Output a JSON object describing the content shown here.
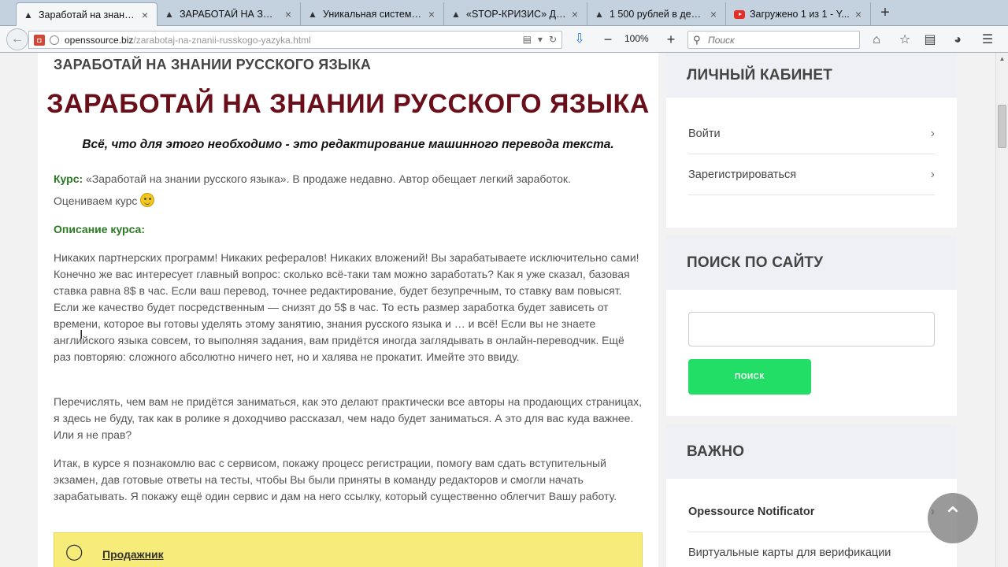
{
  "browser": {
    "tabs": [
      {
        "label": "Заработай на знани...",
        "active": true,
        "icon": "page-icon"
      },
      {
        "label": "ЗАРАБОТАЙ НА ЗНАНИ...",
        "active": false,
        "icon": "page-icon"
      },
      {
        "label": "Уникальная система...",
        "active": false,
        "icon": "page-icon"
      },
      {
        "label": "«STOP-КРИЗИС» До...",
        "active": false,
        "icon": "page-icon"
      },
      {
        "label": "1 500 рублей в день ...",
        "active": false,
        "icon": "page-icon"
      },
      {
        "label": "Загружено 1 из 1 - Y...",
        "active": false,
        "icon": "youtube-icon"
      }
    ],
    "new_tab": "+",
    "url_domain": "openssource.biz",
    "url_path": "/zarabotaj-na-znanii-russkogo-yazyka.html",
    "zoom_minus": "−",
    "zoom_level": "100%",
    "zoom_plus": "+",
    "search_placeholder": "Поиск",
    "accent": "#2a7fd4"
  },
  "article": {
    "breadcrumb_title": "ЗАРАБОТАЙ НА ЗНАНИИ РУССКОГО ЯЗЫКА",
    "title": "ЗАРАБОТАЙ НА ЗНАНИИ РУССКОГО ЯЗЫКА",
    "subtitle": "Всё, что для этого необходимо - это редактирование машинного перевода текста.",
    "course_label": "Курс:",
    "course_text_1": " «Заработай на знании русского языка». В продаже недавно. Автор обещает легкий заработок.",
    "course_text_2": "Оцениваем курс",
    "description_label": "Описание курса:",
    "paragraph_1": "Никаких партнерских программ! Никаких рефералов! Никаких вложений! Вы зарабатываете исключительно сами!  Конечно же вас интересует главный вопрос: сколько всё-таки там можно заработать? Как я уже сказал, базовая ставка равна 8$ в час. Если ваш перевод, точнее редактирование, будет безупречным, то ставку вам повысят. Если же качество будет посредственным — снизят до 5$ в час. То есть размер заработка будет зависеть от времени, которое вы готовы уделять этому занятию, знания русского языка и … и всё! Если вы не знаете английского языка совсем, то выполняя задания, вам придётся иногда заглядывать в онлайн-переводчик. Ещё раз повторяю: сложного абсолютно ничего нет, но и халява не прокатит. Имейте это ввиду.",
    "paragraph_2": "Перечислять, чем вам не придётся заниматься, как это делают практически все авторы на продающих страницах, я здесь не буду, так как в ролике я доходчиво рассказал, чем надо будет заниматься. А это для вас куда важнее. Или я не прав?",
    "paragraph_3": "Итак, в курсе я познакомлю вас с сервисом, покажу процесс регистрации, помогу вам сдать вступительный экзамен, дав готовые ответы на тесты, чтобы Вы были приняты в команду редакторов и смогли начать зарабатывать. Я покажу ещё один сервис и дам на него ссылку, который существенно облегчит Вашу работу.",
    "tip_link": "Продажник",
    "title_color": "#6a0f1a",
    "label_color": "#2a7a22"
  },
  "sidebar": {
    "account": {
      "heading": "ЛИЧНЫЙ КАБИНЕТ",
      "items": [
        {
          "label": "Войти"
        },
        {
          "label": "Зарегистрироваться"
        }
      ]
    },
    "search": {
      "heading": "ПОИСК ПО САЙТУ",
      "value": "",
      "button": "ПОИСК",
      "button_color": "#22dd66"
    },
    "important": {
      "heading": "ВАЖНО",
      "items": [
        {
          "label": "Opessource Notificator"
        },
        {
          "label": "Виртуальные карты для верификации"
        }
      ]
    }
  }
}
